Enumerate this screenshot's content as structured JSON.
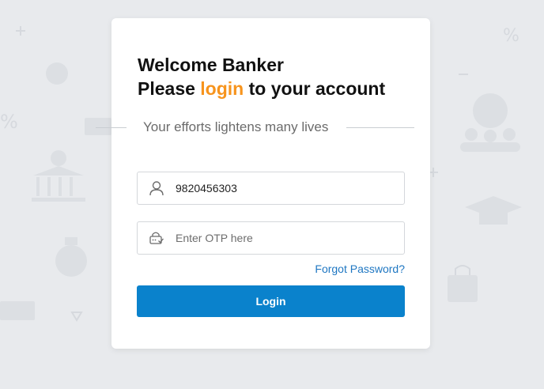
{
  "heading": {
    "line1": "Welcome Banker",
    "line2_prefix": "Please ",
    "line2_accent": "login",
    "line2_suffix": " to your account"
  },
  "tagline": "Your efforts lightens many lives",
  "phone_field": {
    "value": "9820456303",
    "icon": "user-icon"
  },
  "otp_field": {
    "placeholder": "Enter OTP here",
    "value": "",
    "icon": "otp-key-icon"
  },
  "forgot_password": "Forgot Password?",
  "login_button": "Login",
  "colors": {
    "accent": "#f7941d",
    "primary_button": "#0a82cc",
    "link": "#1f77c2",
    "background": "#e8eaed"
  }
}
